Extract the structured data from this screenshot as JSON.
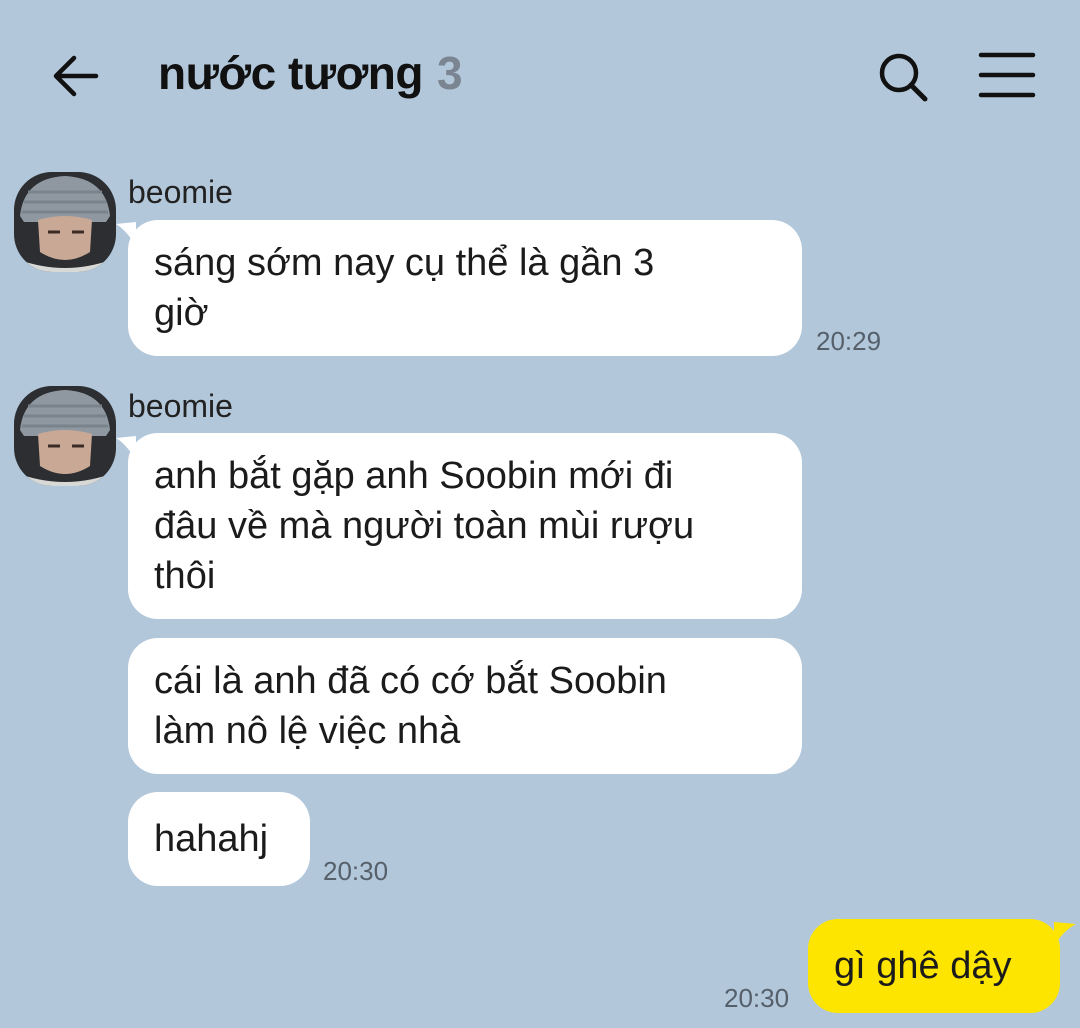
{
  "header": {
    "title": "nước tương",
    "member_count": "3",
    "back_icon": "arrow-left-icon",
    "search_icon": "search-icon",
    "menu_icon": "hamburger-menu-icon"
  },
  "colors": {
    "background": "#b2c7da",
    "incoming_bubble": "#ffffff",
    "outgoing_bubble": "#fee500"
  },
  "messages": [
    {
      "sender": "beomie",
      "lines": [
        "sáng sớm nay cụ thể là gần 3",
        "giờ"
      ],
      "time": "20:29"
    },
    {
      "sender": "beomie",
      "lines": [
        "anh bắt gặp anh Soobin mới đi",
        "đâu về mà người toàn mùi rượu",
        "thôi"
      ]
    },
    {
      "lines": [
        "cái là anh đã có cớ bắt Soobin",
        "làm nô lệ việc nhà"
      ]
    },
    {
      "lines": [
        "hahahj"
      ],
      "time": "20:30"
    },
    {
      "from_me": true,
      "lines": [
        "gì ghê dậy"
      ],
      "time": "20:30"
    }
  ]
}
